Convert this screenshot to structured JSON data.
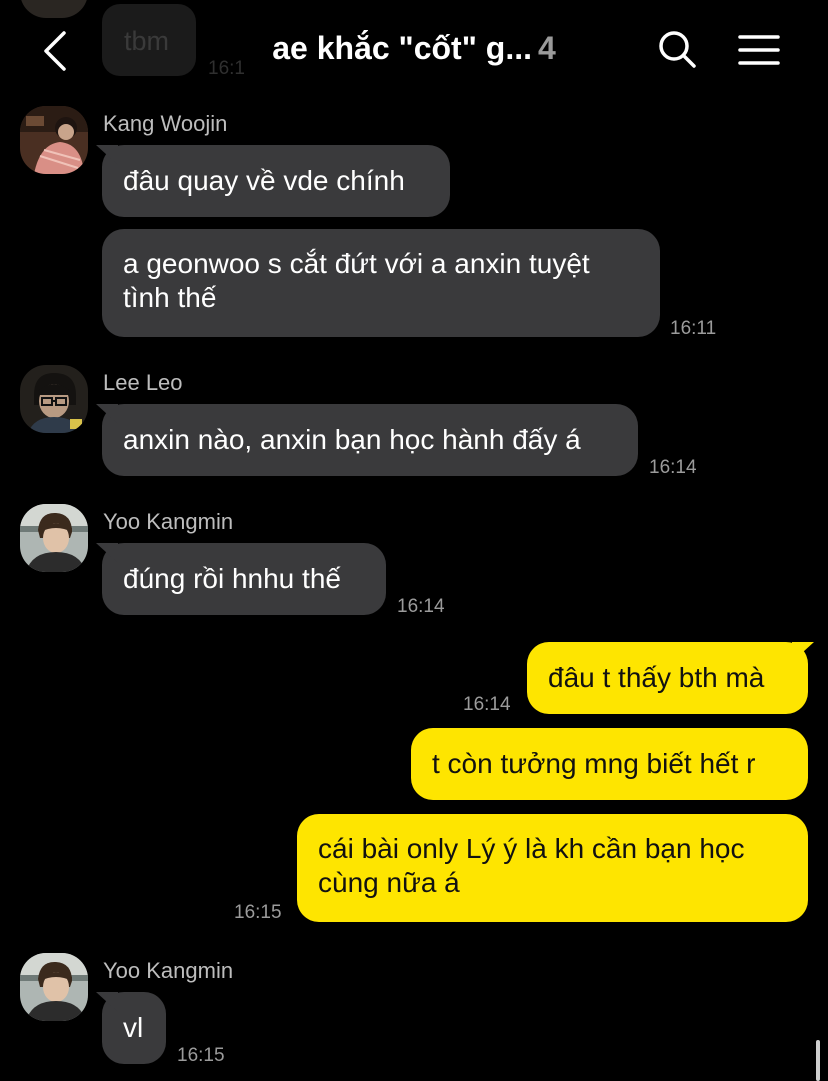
{
  "header": {
    "title": "ae khắc \"cốt\" g...",
    "member_count": "4",
    "icons": {
      "back": "chevron-left-icon",
      "search": "search-icon",
      "menu": "hamburger-menu-icon"
    }
  },
  "colors": {
    "background": "#000000",
    "incoming_bubble": "#3a3a3c",
    "outgoing_bubble": "#fee500",
    "timestamp": "#9b9b9b"
  },
  "partial_top": {
    "text": "tbm",
    "time": "16:1"
  },
  "messages": [
    {
      "sender": "Kang Woojin",
      "bubbles": [
        {
          "text": "đâu quay về vde chính"
        },
        {
          "text": "a geonwoo s cắt đứt với a anxin tuyệt tình thế",
          "time": "16:11"
        }
      ]
    },
    {
      "sender": "Lee Leo",
      "bubbles": [
        {
          "text": "anxin nào, anxin bạn học hành đấy á",
          "time": "16:14"
        }
      ]
    },
    {
      "sender": "Yoo Kangmin",
      "bubbles": [
        {
          "text": "đúng rồi hnhu thế",
          "time": "16:14"
        }
      ]
    },
    {
      "sender": "me",
      "bubbles": [
        {
          "text": "đâu t thấy bth mà",
          "time": "16:14"
        },
        {
          "text": "t còn tưởng mng biết hết r"
        },
        {
          "text": "cái bài only Lý ý là kh cần bạn học cùng nữa á",
          "time": "16:15"
        }
      ]
    },
    {
      "sender": "Yoo Kangmin",
      "bubbles": [
        {
          "text": "vl",
          "time": "16:15"
        }
      ]
    }
  ]
}
